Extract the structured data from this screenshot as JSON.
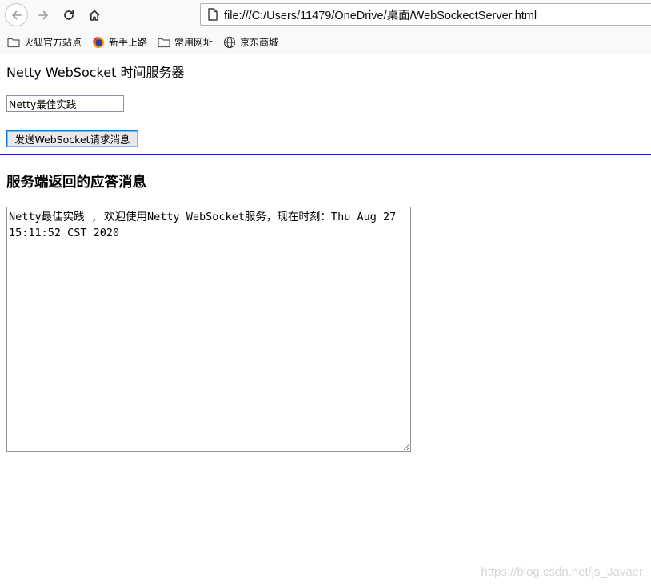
{
  "browser": {
    "url": "file:///C:/Users/11479/OneDrive/桌面/WebSockectServer.html",
    "bookmarks": [
      {
        "label": "火狐官方站点",
        "icon": "folder-icon"
      },
      {
        "label": "新手上路",
        "icon": "firefox-icon"
      },
      {
        "label": "常用网址",
        "icon": "folder-icon"
      },
      {
        "label": "京东商城",
        "icon": "globe-icon"
      }
    ]
  },
  "page": {
    "title": "Netty WebSocket 时间服务器",
    "message_value": "Netty最佳实践",
    "send_button": "发送WebSocket请求消息",
    "response_heading": "服务端返回的应答消息",
    "response_text": "Netty最佳实践 , 欢迎使用Netty WebSocket服务，现在时刻：Thu Aug 27 15:11:52 CST 2020"
  },
  "watermark": "https://blog.csdn.net/js_Javaer",
  "colors": {
    "divider": "#1a1aa6",
    "focus_border": "#0a7cd6"
  }
}
